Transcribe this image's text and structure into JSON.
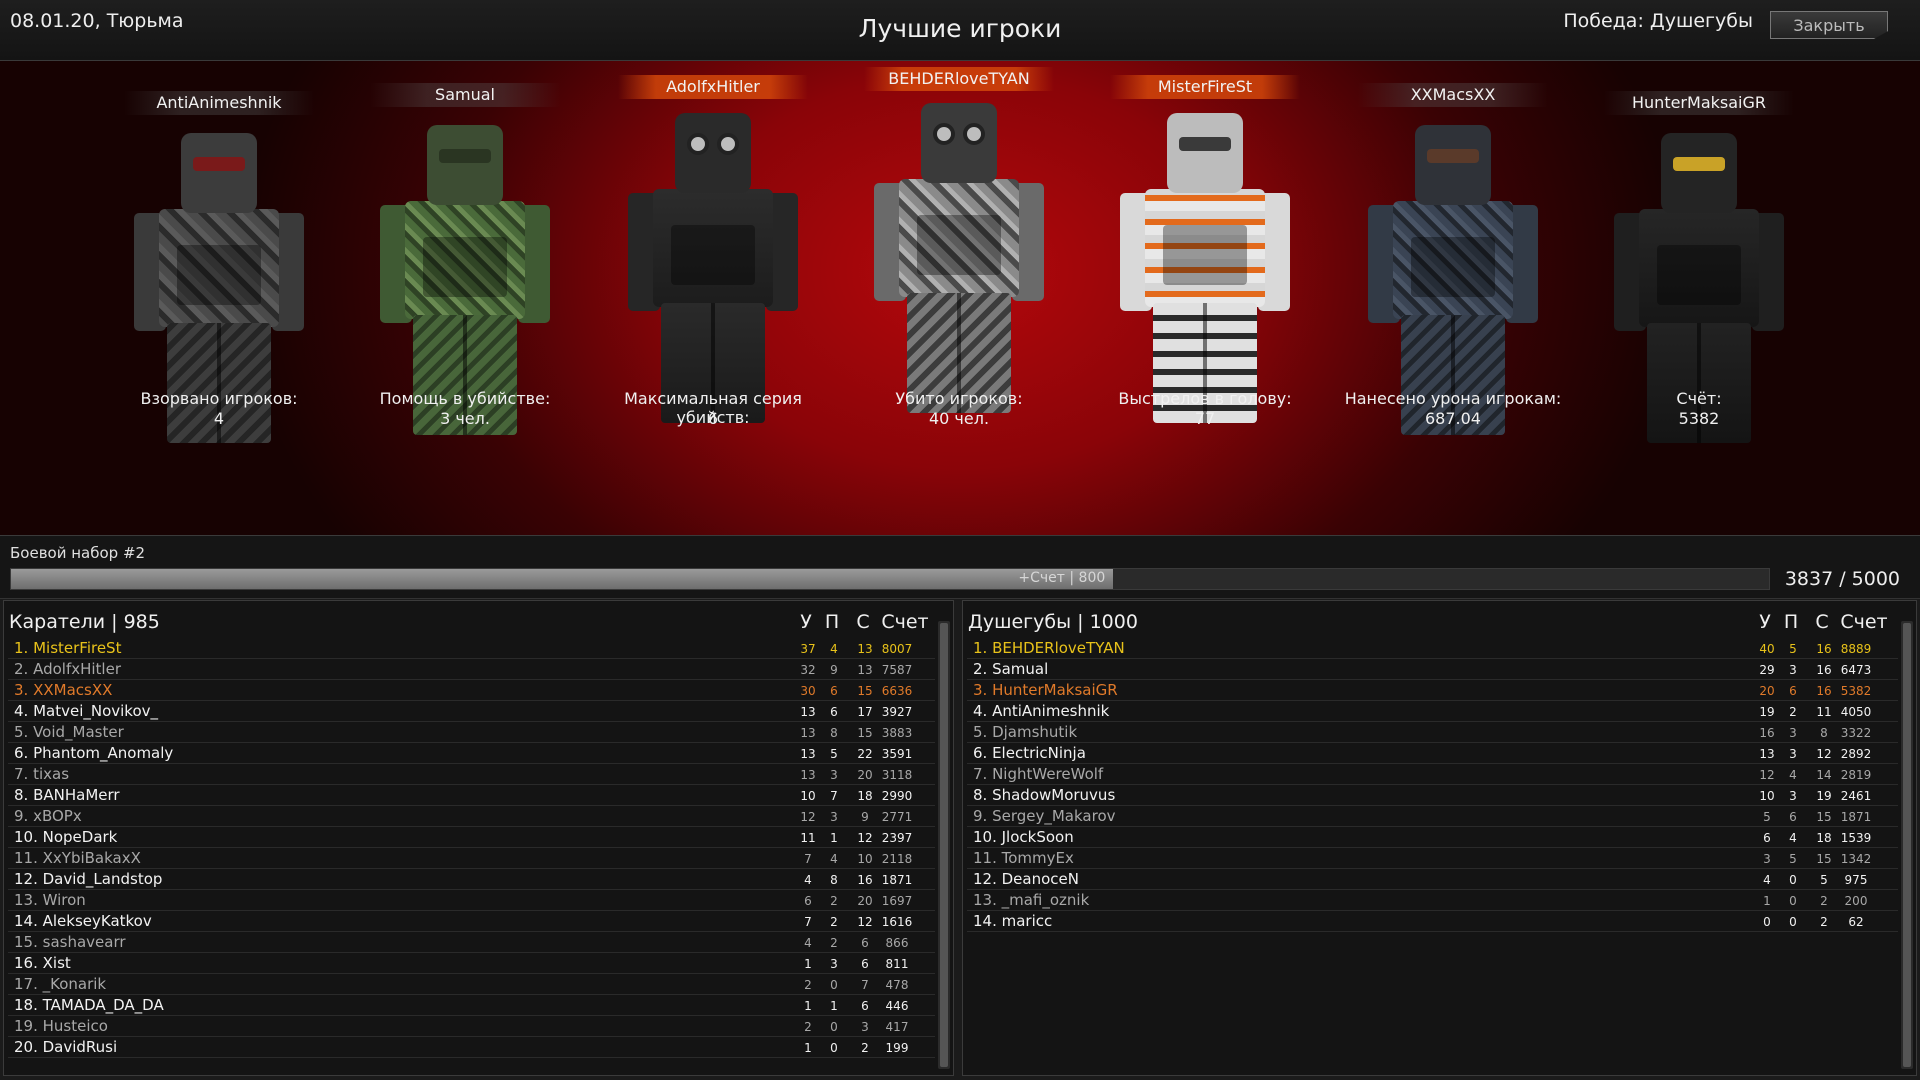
{
  "header": {
    "date_location": "08.01.20, Тюрьма",
    "title": "Лучшие игроки",
    "victory": "Победа: Душегубы",
    "close_label": "Закрыть"
  },
  "top_players": [
    {
      "name": "AntiAnimeshnik",
      "stat_label": "Взорвано игроков:",
      "stat_value": "4",
      "highlight": false,
      "camo": "camo-gray"
    },
    {
      "name": "Samual",
      "stat_label": "Помощь в убийстве:",
      "stat_value": "3 чел.",
      "highlight": false,
      "camo": "camo-green"
    },
    {
      "name": "AdolfxHitler",
      "stat_label": "Максимальная серия убийств:",
      "stat_value": "6",
      "highlight": true,
      "camo": "black-gasmask"
    },
    {
      "name": "BEHDERloveTYAN",
      "stat_label": "Убито игроков:",
      "stat_value": "40 чел.",
      "highlight": true,
      "camo": "camo-urban"
    },
    {
      "name": "MisterFireSt",
      "stat_label": "Выстрелов в голову:",
      "stat_value": "77",
      "highlight": true,
      "camo": "white-orange"
    },
    {
      "name": "XXMacsXX",
      "stat_label": "Нанесено урона игрокам:",
      "stat_value": "687.04",
      "highlight": false,
      "camo": "camo-blue"
    },
    {
      "name": "HunterMaksaiGR",
      "stat_label": "Счёт:",
      "stat_value": "5382",
      "highlight": false,
      "camo": "black-tactical"
    }
  ],
  "progress": {
    "label": "Боевой набор #2",
    "fill_label": "+Счет | 800",
    "current": 3837,
    "max": 5000,
    "fill_fraction": 0.627,
    "total_text": "3837 / 5000"
  },
  "columns": {
    "kills": "У",
    "assists": "П",
    "deaths": "С",
    "score": "Счет"
  },
  "colors": {
    "gold": "#e8c21a",
    "orange": "#e07a2a",
    "white": "#f2f2f2",
    "gray": "#a8a8a8"
  },
  "teams": [
    {
      "header": "Каратели  | 985",
      "rows": [
        {
          "name": "1. MisterFireSt",
          "k": "37",
          "a": "4",
          "d": "13",
          "s": "8007",
          "color": "#e8c21a"
        },
        {
          "name": "2. AdolfxHitler",
          "k": "32",
          "a": "9",
          "d": "13",
          "s": "7587",
          "color": "#a8a8a8"
        },
        {
          "name": "3. XXMacsXX",
          "k": "30",
          "a": "6",
          "d": "15",
          "s": "6636",
          "color": "#e07a2a"
        },
        {
          "name": "4. Matvei_Novikov_",
          "k": "13",
          "a": "6",
          "d": "17",
          "s": "3927",
          "color": "#f2f2f2"
        },
        {
          "name": "5. Void_Master",
          "k": "13",
          "a": "8",
          "d": "15",
          "s": "3883",
          "color": "#a8a8a8"
        },
        {
          "name": "6. Phantom_Anomaly",
          "k": "13",
          "a": "5",
          "d": "22",
          "s": "3591",
          "color": "#f2f2f2"
        },
        {
          "name": "7. tixas",
          "k": "13",
          "a": "3",
          "d": "20",
          "s": "3118",
          "color": "#a8a8a8"
        },
        {
          "name": "8. BANHaMerr",
          "k": "10",
          "a": "7",
          "d": "18",
          "s": "2990",
          "color": "#f2f2f2"
        },
        {
          "name": "9. xBOPx",
          "k": "12",
          "a": "3",
          "d": "9",
          "s": "2771",
          "color": "#a8a8a8"
        },
        {
          "name": "10. NopeDark",
          "k": "11",
          "a": "1",
          "d": "12",
          "s": "2397",
          "color": "#f2f2f2"
        },
        {
          "name": "11. XxYbiBakaxX",
          "k": "7",
          "a": "4",
          "d": "10",
          "s": "2118",
          "color": "#a8a8a8"
        },
        {
          "name": "12. David_Landstop",
          "k": "4",
          "a": "8",
          "d": "16",
          "s": "1871",
          "color": "#f2f2f2"
        },
        {
          "name": "13. Wiron",
          "k": "6",
          "a": "2",
          "d": "20",
          "s": "1697",
          "color": "#a8a8a8"
        },
        {
          "name": "14. AlekseyKatkov",
          "k": "7",
          "a": "2",
          "d": "12",
          "s": "1616",
          "color": "#f2f2f2"
        },
        {
          "name": "15. sashavearr",
          "k": "4",
          "a": "2",
          "d": "6",
          "s": "866",
          "color": "#a8a8a8"
        },
        {
          "name": "16. Xist",
          "k": "1",
          "a": "3",
          "d": "6",
          "s": "811",
          "color": "#f2f2f2"
        },
        {
          "name": "17. _Konarik",
          "k": "2",
          "a": "0",
          "d": "7",
          "s": "478",
          "color": "#a8a8a8"
        },
        {
          "name": "18. TAMADA_DA_DA",
          "k": "1",
          "a": "1",
          "d": "6",
          "s": "446",
          "color": "#f2f2f2"
        },
        {
          "name": "19. Husteico",
          "k": "2",
          "a": "0",
          "d": "3",
          "s": "417",
          "color": "#a8a8a8"
        },
        {
          "name": "20. DavidRusi",
          "k": "1",
          "a": "0",
          "d": "2",
          "s": "199",
          "color": "#f2f2f2"
        }
      ]
    },
    {
      "header": "Душегубы  | 1000",
      "rows": [
        {
          "name": "1. BEHDERloveTYAN",
          "k": "40",
          "a": "5",
          "d": "16",
          "s": "8889",
          "color": "#e8c21a"
        },
        {
          "name": "2. Samual",
          "k": "29",
          "a": "3",
          "d": "16",
          "s": "6473",
          "color": "#f2f2f2"
        },
        {
          "name": "3. HunterMaksaiGR",
          "k": "20",
          "a": "6",
          "d": "16",
          "s": "5382",
          "color": "#e07a2a"
        },
        {
          "name": "4. AntiAnimeshnik",
          "k": "19",
          "a": "2",
          "d": "11",
          "s": "4050",
          "color": "#f2f2f2"
        },
        {
          "name": "5. Djamshutik",
          "k": "16",
          "a": "3",
          "d": "8",
          "s": "3322",
          "color": "#a8a8a8"
        },
        {
          "name": "6. ElectricNinja",
          "k": "13",
          "a": "3",
          "d": "12",
          "s": "2892",
          "color": "#f2f2f2"
        },
        {
          "name": "7. NightWereWolf",
          "k": "12",
          "a": "4",
          "d": "14",
          "s": "2819",
          "color": "#a8a8a8"
        },
        {
          "name": "8. ShadowMoruvus",
          "k": "10",
          "a": "3",
          "d": "19",
          "s": "2461",
          "color": "#f2f2f2"
        },
        {
          "name": "9. Sergey_Makarov",
          "k": "5",
          "a": "6",
          "d": "15",
          "s": "1871",
          "color": "#a8a8a8"
        },
        {
          "name": "10. JlockSoon",
          "k": "6",
          "a": "4",
          "d": "18",
          "s": "1539",
          "color": "#f2f2f2"
        },
        {
          "name": "11. TommyEx",
          "k": "3",
          "a": "5",
          "d": "15",
          "s": "1342",
          "color": "#a8a8a8"
        },
        {
          "name": "12. DeanoceN",
          "k": "4",
          "a": "0",
          "d": "5",
          "s": "975",
          "color": "#f2f2f2"
        },
        {
          "name": "13. _mafi_oznik",
          "k": "1",
          "a": "0",
          "d": "2",
          "s": "200",
          "color": "#a8a8a8"
        },
        {
          "name": "14. maricc",
          "k": "0",
          "a": "0",
          "d": "2",
          "s": "62",
          "color": "#f2f2f2"
        }
      ]
    }
  ]
}
